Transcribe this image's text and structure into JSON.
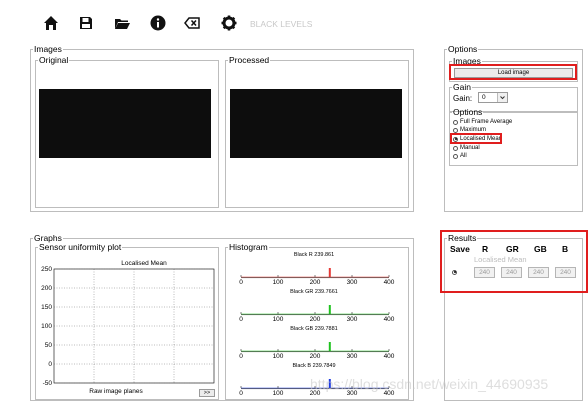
{
  "toolbar": {
    "icons": [
      "home-icon",
      "save-icon",
      "open-folder-icon",
      "info-icon",
      "backspace-icon",
      "gear-icon"
    ],
    "title": "BLACK LEVELS"
  },
  "images_panel": {
    "title": "Images",
    "original_title": "Original",
    "processed_title": "Processed"
  },
  "graphs_panel": {
    "title": "Graphs",
    "uniformity": {
      "title": "Sensor uniformity plot",
      "plot_title": "Localised Mean",
      "xlabel": "Raw image planes",
      "next_button": ">>"
    },
    "histogram": {
      "title": "Histogram"
    }
  },
  "options_panel": {
    "title": "Options",
    "images_title": "Images",
    "load_button": "Load image",
    "gain_title": "Gain",
    "gain_label": "Gain:",
    "gain_value": "0",
    "options_title": "Options",
    "options": [
      {
        "label": "Full Frame Average",
        "selected": false
      },
      {
        "label": "Maximum",
        "selected": false
      },
      {
        "label": "Localised Mean",
        "selected": true
      },
      {
        "label": "Manual",
        "selected": false
      },
      {
        "label": "All",
        "selected": false
      }
    ]
  },
  "results_panel": {
    "title": "Results",
    "headers": [
      "Save",
      "R",
      "GR",
      "GB",
      "B"
    ],
    "mode_label": "Localised Mean",
    "values": [
      "240",
      "240",
      "240",
      "240"
    ]
  },
  "colors": {
    "highlight": "#e01e1e",
    "red": "#e53935",
    "green": "#1ec21e",
    "blue": "#1e3ae0"
  },
  "chart_data": [
    {
      "type": "line",
      "title": "Localised Mean",
      "xlabel": "Raw image planes",
      "ylabel": "",
      "ylim": [
        -50,
        250
      ],
      "yticks": [
        "250",
        "200",
        "150",
        "100",
        "50",
        "0",
        "-50"
      ],
      "grid": true,
      "series": []
    },
    {
      "type": "bar",
      "subplots": [
        {
          "title": "Black R 239.861",
          "peak": 240,
          "color": "#e53935"
        },
        {
          "title": "Black GR 239.7661",
          "peak": 240,
          "color": "#1ec21e"
        },
        {
          "title": "Black GB 239.7881",
          "peak": 240,
          "color": "#1ec21e"
        },
        {
          "title": "Black B 239.7849",
          "peak": 240,
          "color": "#1e3ae0"
        }
      ],
      "xticks": [
        "0",
        "100",
        "200",
        "300",
        "400"
      ],
      "xlim": [
        0,
        400
      ]
    }
  ],
  "watermark": "https://blog.csdn.net/weixin_44690935"
}
